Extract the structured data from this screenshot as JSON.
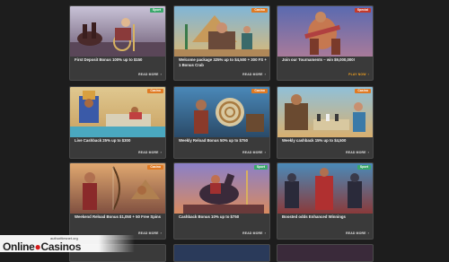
{
  "colors": {
    "page_bg": "#1d1d1d",
    "card_bg": "#3a3a3a",
    "badge_green": "#3aa86b",
    "badge_orange": "#e07a23",
    "badge_red": "#c43a2b",
    "link_orange": "#f0a020"
  },
  "cards": [
    {
      "title": "First Deposit Bonus 100% up to $150",
      "badge": "Sport",
      "badge_color": "#3aa86b",
      "action": "READ MORE",
      "scene": "chariot-scene"
    },
    {
      "title": "Welcome package 325% up to $4,500 + 300 FS + 1 Bonus Crab",
      "badge": "Casino",
      "badge_color": "#e07a23",
      "action": "READ MORE",
      "scene": "pyramid-scene"
    },
    {
      "title": "Join our Tournaments – win $9,000,000!",
      "badge": "Special",
      "badge_color": "#c43a2b",
      "action": "PLAY NOW",
      "scene": "warrior-scene"
    },
    {
      "title": "Live Cashback 25% up to $300",
      "badge": "Casino",
      "badge_color": "#e07a23",
      "action": "READ MORE",
      "scene": "pharaoh-scene"
    },
    {
      "title": "Weekly Reload Bonus 50% up to $750",
      "badge": "Casino",
      "badge_color": "#e07a23",
      "action": "READ MORE",
      "scene": "shield-scene"
    },
    {
      "title": "Weekly cashback 15% up to $4,500",
      "badge": "Casino",
      "badge_color": "#e07a23",
      "action": "READ MORE",
      "scene": "chess-scene"
    },
    {
      "title": "Weekend Reload Bonus $1,050 + 50 Free Spins",
      "badge": "Casino",
      "badge_color": "#e07a23",
      "action": "READ MORE",
      "scene": "archer-scene"
    },
    {
      "title": "Cashback Bonus 10% up to $750",
      "badge": "Sport",
      "badge_color": "#3aa86b",
      "action": "READ MORE",
      "scene": "horse-scene"
    },
    {
      "title": "Boosted odds Enhanced Winnings",
      "badge": "Sport",
      "badge_color": "#3aa86b",
      "action": "READ MORE",
      "scene": "knights-scene"
    }
  ],
  "footer": {
    "logo_prefix": "Online",
    "logo_suffix": "Casinos",
    "logo_sub": "authoritiesnet.org"
  }
}
